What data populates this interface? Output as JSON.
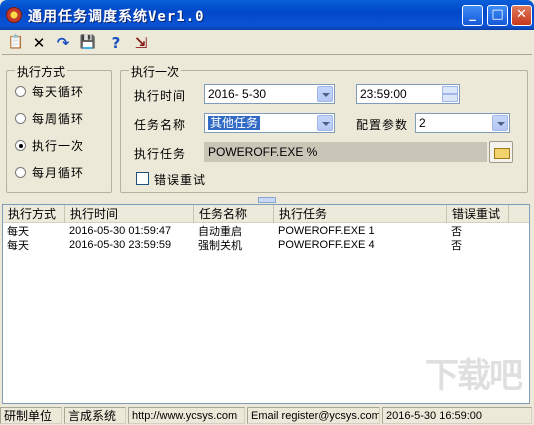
{
  "window": {
    "title": "通用任务调度系统Ver1.0",
    "minimize": "_",
    "maximize": "□",
    "close": "✕"
  },
  "toolbar": [
    {
      "icon": "new-task-icon",
      "glyph": "📋"
    },
    {
      "icon": "delete-icon",
      "glyph": "✕"
    },
    {
      "icon": "refresh-icon",
      "glyph": "↷"
    },
    {
      "icon": "save-icon",
      "glyph": "💾"
    },
    {
      "icon": "help-icon",
      "glyph": "?"
    },
    {
      "icon": "exit-icon",
      "glyph": "⇲"
    }
  ],
  "exec_mode": {
    "legend": "执行方式",
    "options": [
      "每天循环",
      "每周循环",
      "执行一次",
      "每月循环"
    ],
    "selected": "执行一次"
  },
  "exec_once": {
    "legend": "执行一次",
    "time_label": "执行时间",
    "date_value": "2016- 5-30",
    "time_value": "23:59:00",
    "task_name_label": "任务名称",
    "task_name_value": "其他任务",
    "param_label": "配置参数",
    "param_value": "2",
    "exec_task_label": "执行任务",
    "exec_task_value": "POWEROFF.EXE %",
    "retry_label": "错误重试",
    "retry_checked": false
  },
  "table": {
    "columns": [
      "执行方式",
      "执行时间",
      "任务名称",
      "执行任务",
      "错误重试"
    ],
    "rows": [
      [
        "每天",
        "2016-05-30 01:59:47",
        "自动重启",
        "POWEROFF.EXE 1",
        "否"
      ],
      [
        "每天",
        "2016-05-30 23:59:59",
        "强制关机",
        "POWEROFF.EXE 4",
        "否"
      ]
    ]
  },
  "status": {
    "dev_unit_label": "研制单位",
    "company": "言成系统",
    "url": "http://www.ycsys.com",
    "email": "Email register@ycsys.com",
    "datetime": "2016-5-30 16:59:00"
  },
  "watermark": "下载吧",
  "colors": {
    "titlebar": "#0048c8",
    "selection": "#316ac5",
    "window_bg": "#ece9d8"
  }
}
